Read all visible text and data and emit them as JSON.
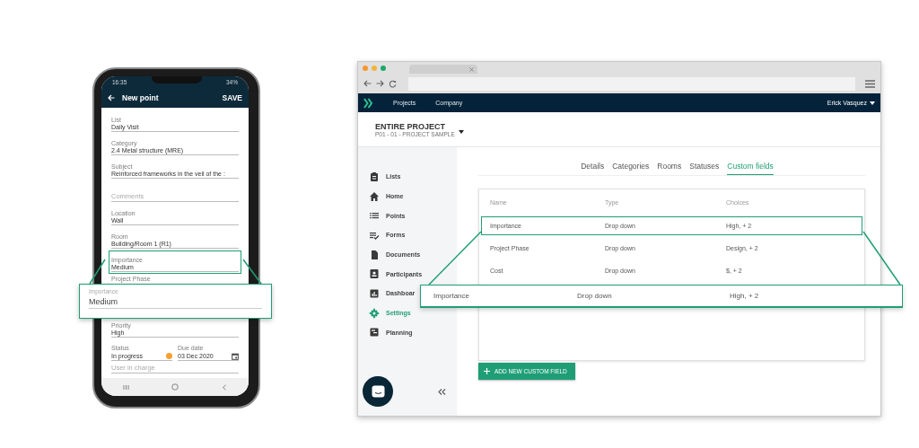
{
  "phone": {
    "status_bar": {
      "time": "16:35",
      "battery": "34%"
    },
    "header": {
      "title": "New point",
      "action": "SAVE"
    },
    "fields": [
      {
        "kind": "text",
        "label": "List",
        "value": "Daily Visit",
        "highlighted": false
      },
      {
        "kind": "text",
        "label": "Category",
        "value": "2.4 Metal structure (MRE)",
        "highlighted": false
      },
      {
        "kind": "text",
        "label": "Subject",
        "value": "Reinforced frameworks in the veil of the :",
        "highlighted": false
      },
      {
        "kind": "placeholder",
        "placeholder": "Comments",
        "highlighted": false
      },
      {
        "kind": "text",
        "label": "Location",
        "value": "Wall",
        "highlighted": false
      },
      {
        "kind": "text",
        "label": "Room",
        "value": "Building/Room 1 (R1)",
        "highlighted": false
      },
      {
        "kind": "text",
        "label": "Importance",
        "value": "Medium",
        "highlighted": true
      },
      {
        "kind": "label_only",
        "label": "Project Phase",
        "highlighted": false
      },
      {
        "kind": "text",
        "label": "Priority",
        "value": "High",
        "highlighted": false
      },
      {
        "kind": "pair",
        "items": [
          {
            "label": "Status",
            "value": "In progress"
          },
          {
            "label": "Due date",
            "value": "03 Dec 2020"
          }
        ]
      },
      {
        "kind": "placeholder",
        "placeholder": "User in charge",
        "highlighted": false
      }
    ],
    "callout": {
      "label": "Importance",
      "value": "Medium"
    }
  },
  "browser": {
    "navbar": {
      "links": [
        "Projects",
        "Company"
      ],
      "user": "Erick Vasquez"
    },
    "project": {
      "title": "ENTIRE PROJECT",
      "subtitle": "P01 - 01 - PROJECT SAMPLE"
    },
    "sidebar": {
      "items": [
        {
          "label": "Lists",
          "selected": false
        },
        {
          "label": "Home",
          "selected": false
        },
        {
          "label": "Points",
          "selected": false
        },
        {
          "label": "Forms",
          "selected": false
        },
        {
          "label": "Documents",
          "selected": false
        },
        {
          "label": "Participants",
          "selected": false
        },
        {
          "label": "Dashboar",
          "selected": false
        },
        {
          "label": "Settings",
          "selected": true
        },
        {
          "label": "Planning",
          "selected": false
        }
      ]
    },
    "tabs": [
      {
        "label": "Details",
        "selected": false
      },
      {
        "label": "Categories",
        "selected": false
      },
      {
        "label": "Rooms",
        "selected": false
      },
      {
        "label": "Statuses",
        "selected": false
      },
      {
        "label": "Custom fields",
        "selected": true
      }
    ],
    "table": {
      "columns": [
        "Name",
        "Type",
        "Choices"
      ],
      "rows": [
        {
          "cells": [
            "Importance",
            "Drop down",
            "High, + 2"
          ],
          "highlighted": true
        },
        {
          "cells": [
            "Project Phase",
            "Drop down",
            "Design, + 2"
          ],
          "highlighted": false
        },
        {
          "cells": [
            "Cost",
            "Drop down",
            "$, + 2"
          ],
          "highlighted": false
        }
      ]
    },
    "add_button": "ADD NEW CUSTOM FIELD",
    "callout": {
      "cells": [
        "Importance",
        "Drop down",
        "High, + 2"
      ]
    }
  }
}
